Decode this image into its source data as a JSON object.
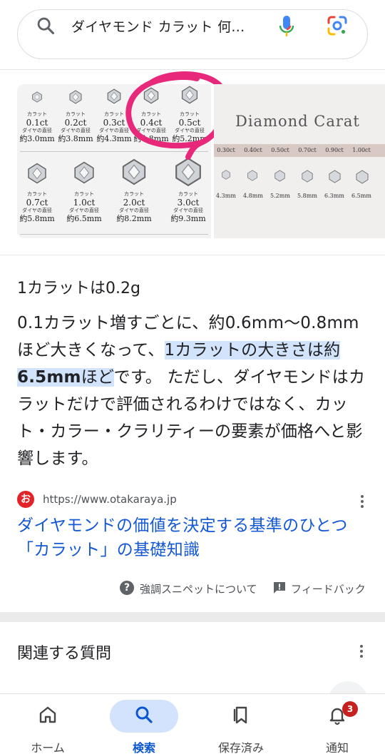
{
  "search": {
    "query": "ダイヤモンド カラット 何..."
  },
  "image_panel": {
    "grid_small": [
      {
        "ct": "0.1ct",
        "mm": "約3.0mm"
      },
      {
        "ct": "0.2ct",
        "mm": "約3.8mm"
      },
      {
        "ct": "0.3ct",
        "mm": "約4.3mm"
      },
      {
        "ct": "0.4ct",
        "mm": "約4.8mm"
      },
      {
        "ct": "0.5ct",
        "mm": "約5.2mm"
      }
    ],
    "grid_large": [
      {
        "ct": "0.7ct",
        "mm": "約5.8mm"
      },
      {
        "ct": "1.0ct",
        "mm": "約6.5mm"
      },
      {
        "ct": "2.0ct",
        "mm": "約8.2mm"
      },
      {
        "ct": "3.0ct",
        "mm": "約9.3mm"
      }
    ],
    "carat_word": "カラット",
    "diameter_word": "ダイヤの直径",
    "brand_title": "Diamond Carat",
    "strip_carats": [
      "0.30ct",
      "0.40ct",
      "0.50ct",
      "0.70ct",
      "0.90ct",
      "1.00ct"
    ],
    "strip_mm": [
      "4.3mm",
      "4.8mm",
      "5.2mm",
      "5.8mm",
      "6.3mm",
      "6.5mm"
    ],
    "highlight_color": "#e8287a"
  },
  "snippet": {
    "answer_title": "1カラットは0.2g",
    "text_before": "0.1カラット増すごとに、約0.6mm〜0.8mmほど大きくなって、",
    "hl_part1": "1カラットの大きさは約",
    "hl_bold": "6.5mm",
    "hl_part2": "ほど",
    "text_after": "です。 ただし、ダイヤモンドはカラットだけで評価されるわけではなく、カット・カラー・クラリティーの要素が価格へと影響します。",
    "source_url": "https://www.otakaraya.jp",
    "favicon_text": "お",
    "result_title": "ダイヤモンドの価値を決定する基準のひとつ「カラット」の基礎知識",
    "about_label": "強調スニペットについて",
    "feedback_label": "フィードバック"
  },
  "related": {
    "title": "関連する質問"
  },
  "nav": {
    "home": "ホーム",
    "search": "検索",
    "saved": "保存済み",
    "notifications": "通知",
    "badge_count": "3"
  },
  "colors": {
    "link": "#1558d6",
    "highlight_bg": "#d2e3fc",
    "active_nav": "#0b57d0",
    "badge": "#c5221f"
  }
}
